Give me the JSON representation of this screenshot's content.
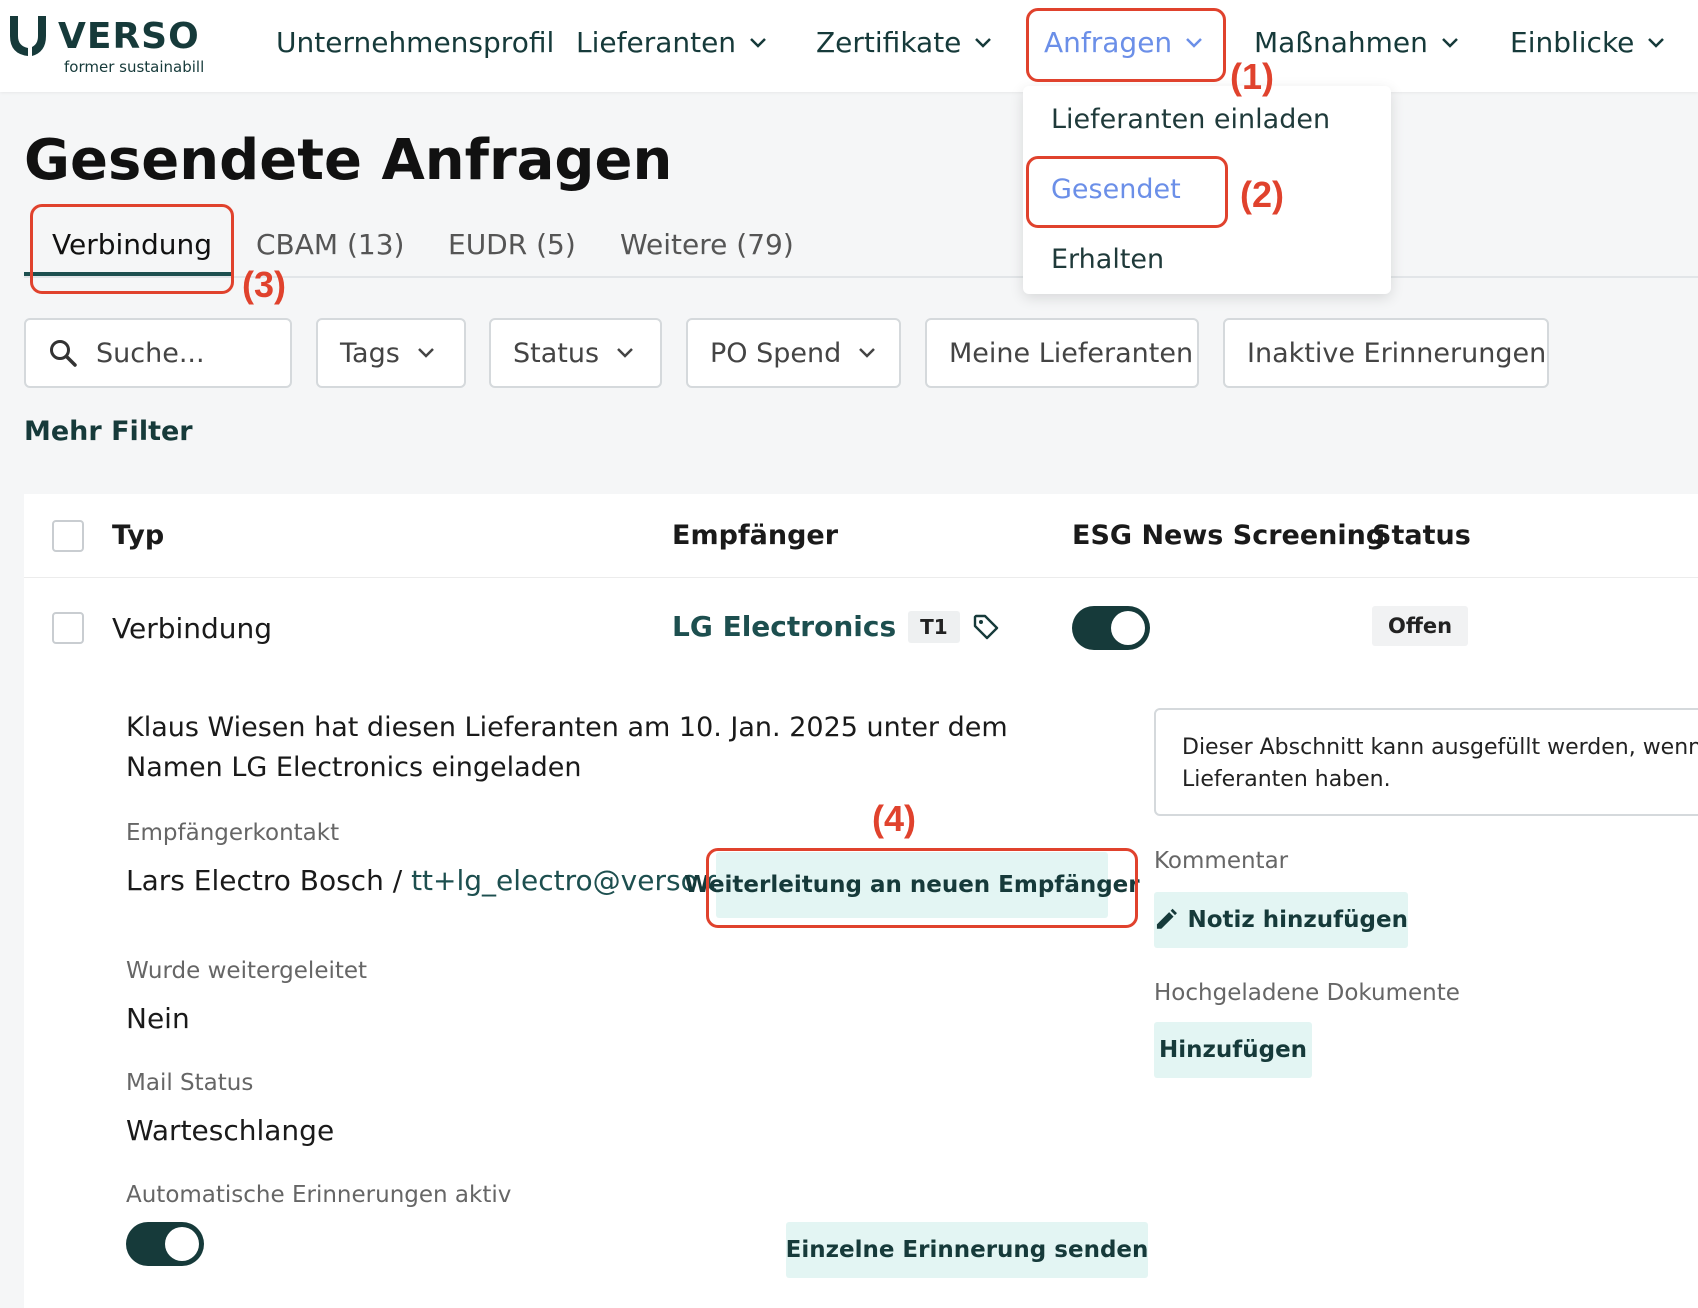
{
  "brand": {
    "name": "VERSO",
    "subtitle": "former sustainabill"
  },
  "nav": {
    "items": [
      {
        "label": "Unternehmensprofil"
      },
      {
        "label": "Lieferanten"
      },
      {
        "label": "Zertifikate"
      },
      {
        "label": "Anfragen"
      },
      {
        "label": "Maßnahmen"
      },
      {
        "label": "Einblicke"
      }
    ],
    "dropdown": [
      "Lieferanten einladen",
      "Gesendet",
      "Erhalten"
    ]
  },
  "page": {
    "title": "Gesendete Anfragen"
  },
  "tabs": [
    "Verbindung",
    "CBAM (13)",
    "EUDR (5)",
    "Weitere (79)"
  ],
  "filters": {
    "search_placeholder": "Suche...",
    "tags": "Tags",
    "status": "Status",
    "po_spend": "PO Spend",
    "my_suppliers": "Meine Lieferanten",
    "inactive_reminders": "Inaktive Erinnerungen",
    "more": "Mehr Filter"
  },
  "table": {
    "headers": {
      "type": "Typ",
      "recipient": "Empfänger",
      "esg": "ESG News Screening",
      "status": "Status"
    },
    "row": {
      "type": "Verbindung",
      "recipient": "LG Electronics",
      "tier": "T1",
      "esg_screening_on": true,
      "status": "Offen"
    }
  },
  "details": {
    "invited_text": "Klaus Wiesen hat diesen Lieferanten am 10. Jan. 2025 unter dem Namen LG Electronics eingeladen",
    "contact_label": "Empfängerkontakt",
    "contact_name": "Lars Electro Bosch / ",
    "contact_email": "tt+lg_electro@verso.de",
    "forward_button": "Weiterleitung an neuen Empfänger",
    "forwarded_label": "Wurde weitergeleitet",
    "forwarded_value": "Nein",
    "mail_status_label": "Mail Status",
    "mail_status_value": "Warteschlange",
    "auto_reminders_label": "Automatische Erinnerungen aktiv",
    "auto_reminders_on": true,
    "single_reminder_button": "Einzelne Erinnerung senden",
    "info_box_line1": "Dieser Abschnitt kann ausgefüllt werden, wenn S",
    "info_box_line2": "Lieferanten haben.",
    "comment_label": "Kommentar",
    "add_note_button": "Notiz hinzufügen",
    "docs_label": "Hochgeladene Dokumente",
    "add_button": "Hinzufügen"
  },
  "annotations": [
    "(1)",
    "(2)",
    "(3)",
    "(4)"
  ],
  "colors": {
    "primary": "#163a3a",
    "link_active": "#6b8fe8",
    "highlight": "#e0422d",
    "mint": "#e3f5f3"
  }
}
